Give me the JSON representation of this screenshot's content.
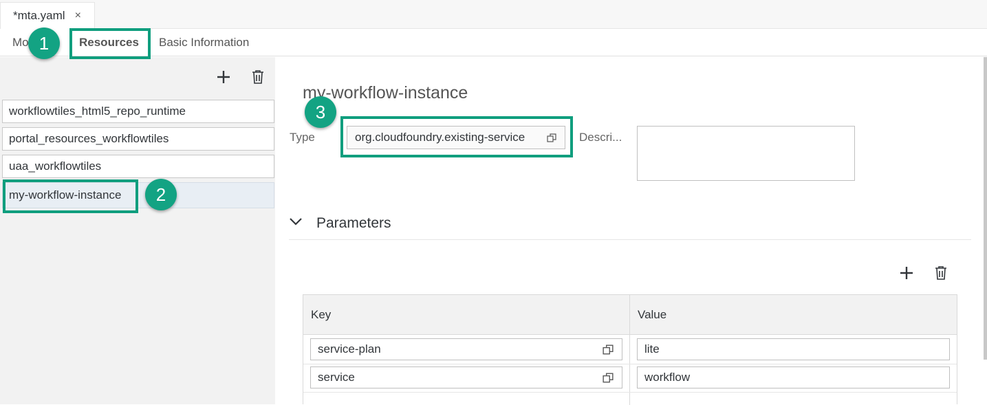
{
  "editor": {
    "tab_label": "*mta.yaml",
    "close_glyph": "×"
  },
  "section_tabs": {
    "modules": "Mo",
    "resources": "Resources",
    "basic_information": "Basic Information"
  },
  "left_pane": {
    "add_icon": "plus-icon",
    "delete_icon": "trash-icon",
    "items": [
      "workflowtiles_html5_repo_runtime",
      "portal_resources_workflowtiles",
      "uaa_workflowtiles",
      "my-workflow-instance"
    ],
    "selected_index": 3
  },
  "detail": {
    "title": "my-workflow-instance",
    "type_label": "Type",
    "type_value": "org.cloudfoundry.existing-service",
    "description_label": "Descri...",
    "description_value": ""
  },
  "parameters": {
    "title": "Parameters",
    "columns": [
      "Key",
      "Value"
    ],
    "rows": [
      {
        "key": "service-plan",
        "value": "lite"
      },
      {
        "key": "service",
        "value": "workflow"
      }
    ]
  },
  "annotations": {
    "badge_1": "1",
    "badge_2": "2",
    "badge_3": "3",
    "highlight_color": "#0f9e7e",
    "badge_color": "#13a383"
  }
}
